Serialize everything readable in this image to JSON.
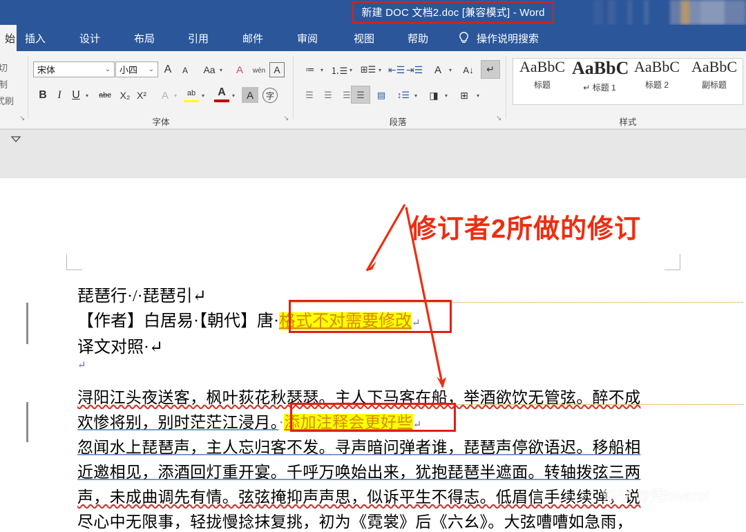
{
  "window": {
    "title": "新建 DOC 文档2.doc [兼容模式]  -  Word",
    "title_highlight_color": "#e02010",
    "chrome_color": "#2b579a"
  },
  "tabs": {
    "active": "始",
    "items": [
      {
        "label": "插入"
      },
      {
        "label": "设计"
      },
      {
        "label": "布局"
      },
      {
        "label": "引用"
      },
      {
        "label": "邮件"
      },
      {
        "label": "审阅"
      },
      {
        "label": "视图"
      },
      {
        "label": "帮助"
      }
    ],
    "tell_me": "操作说明搜索",
    "tell_me_icon": "lightbulb-icon"
  },
  "ribbon": {
    "clipboard": {
      "lines": [
        "切",
        "制",
        "式刷"
      ],
      "launcher": "↘"
    },
    "font": {
      "group_label": "字体",
      "font_name": "宋体",
      "font_size": "小四",
      "grow_font": "A",
      "shrink_font": "A",
      "change_case": "Aa",
      "clear_format": "A",
      "phonetic": "wén",
      "char_border": "A",
      "bold": "B",
      "italic": "I",
      "underline": "U",
      "strikethrough": "abc",
      "subscript": "X₂",
      "superscript": "X²",
      "text_effects": "A",
      "highlight": "ab",
      "font_color": "A",
      "char_shading": "A",
      "enclose_char": "字",
      "highlight_color": "#ffff00",
      "font_color_swatch": "#c00000",
      "launcher": "↘"
    },
    "paragraph": {
      "group_label": "段落",
      "bullets": "bullet-list-icon",
      "numbering": "numbered-list-icon",
      "multilevel": "multilevel-list-icon",
      "decrease_indent": "decrease-indent-icon",
      "increase_indent": "increase-indent-icon",
      "asian_layout": "asian-layout-icon",
      "sort": "sort-icon",
      "show_marks": "show-formatting-marks-icon",
      "align_left": "align-left-icon",
      "align_center": "align-center-icon",
      "align_right": "align-right-icon",
      "justify": "justify-icon",
      "distribute": "distribute-icon",
      "line_spacing": "line-spacing-icon",
      "shading": "shading-icon",
      "borders": "borders-icon",
      "launcher": "↘"
    },
    "styles": {
      "group_label": "样式",
      "items": [
        {
          "preview": "AaBbC",
          "name": "标题",
          "weight": "normal",
          "size": 22
        },
        {
          "preview": "AaBbC",
          "name": "标题 1",
          "weight": "bold",
          "size": 26,
          "prefix": "↵"
        },
        {
          "preview": "AaBbC",
          "name": "标题 2",
          "weight": "normal",
          "size": 22
        },
        {
          "preview": "AaBbC",
          "name": "副标题",
          "weight": "normal",
          "size": 22
        }
      ]
    }
  },
  "document": {
    "lines": [
      {
        "id": "l1",
        "text": "琵琶行·/·琵琶引↵"
      },
      {
        "id": "l2a",
        "text": "【作者】白居易·【朝代】唐·"
      },
      {
        "id": "l2comment",
        "text": "格式不对需要修改"
      },
      {
        "id": "l3",
        "text": "译文对照·↵"
      },
      {
        "id": "l4",
        "text": "↵"
      },
      {
        "id": "l5",
        "text": "浔阳江头夜送客，枫叶荻花秋瑟瑟。主人下马客在船，举酒欲饮无管弦。醉不成"
      },
      {
        "id": "l6a",
        "text": "欢惨将别，别时茫茫江浸月。"
      },
      {
        "id": "l6comment",
        "text": "添加注释会更好些"
      },
      {
        "id": "l7",
        "text": "忽闻水上琵琶声，主人忘归客不发。寻声暗问弹者谁，琵琶声停欲语迟。移船相"
      },
      {
        "id": "l8",
        "text": "近邀相见，添酒回灯重开宴。千呼万唤始出来，犹抱琵琶半遮面。转轴拨弦三两"
      },
      {
        "id": "l9",
        "text": "声，未成曲调先有情。弦弦掩抑声声思，似诉平生不得志。低眉信手续续弹，说"
      },
      {
        "id": "l10",
        "text": "尽心中无限事，轻拢慢捻抹复挑，初为《霓裳》后《六幺》。大弦嘈嘈如急雨，"
      }
    ],
    "comment_color": "#d68a00",
    "comment_highlight": "#ffff00",
    "change_bar_color": "#8d8d8d"
  },
  "annotation": {
    "text": "修订者2所做的修订",
    "color": "#ee2d11",
    "arrow": "arrow-pointer"
  },
  "watermark": {
    "text": "知乎 @凭kwarei"
  }
}
